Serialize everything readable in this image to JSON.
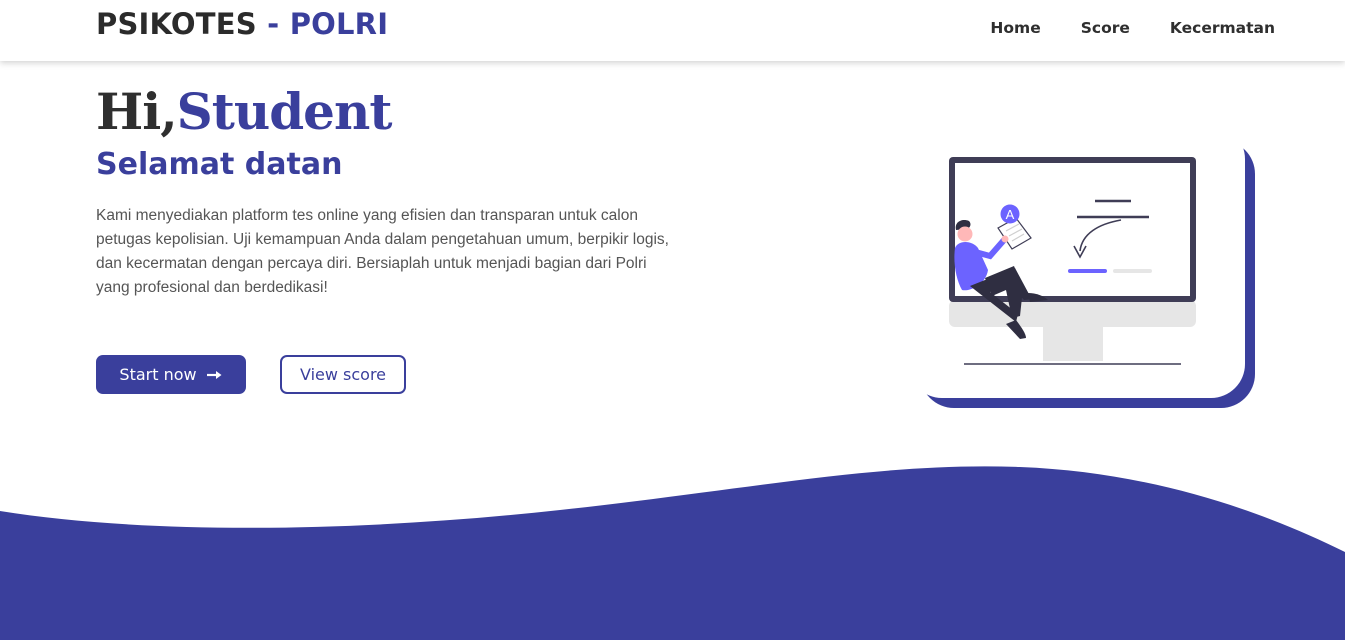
{
  "header": {
    "brand_part1": "PSIKOTES",
    "brand_sep": " - ",
    "brand_part2": "POLRI",
    "nav": [
      "Home",
      "Score",
      "Kecermatan"
    ]
  },
  "hero": {
    "greeting_prefix": "Hi,",
    "greeting_name": "Student",
    "welcome": "Selamat datan",
    "description": "Kami menyediakan platform tes online yang efisien dan transparan untuk calon petugas kepolisian. Uji kemampuan Anda dalam pengetahuan umum, berpikir logis, dan kecermatan dengan percaya diri. Bersiaplah untuk menjadi bagian dari Polri yang profesional dan berdedikasi!",
    "start_label": "Start now",
    "score_label": "View score"
  },
  "illustration": {
    "badge_letter": "A"
  },
  "colors": {
    "primary": "#3a3f9c",
    "accent_purple": "#6c63ff",
    "dark": "#3f3d56"
  }
}
